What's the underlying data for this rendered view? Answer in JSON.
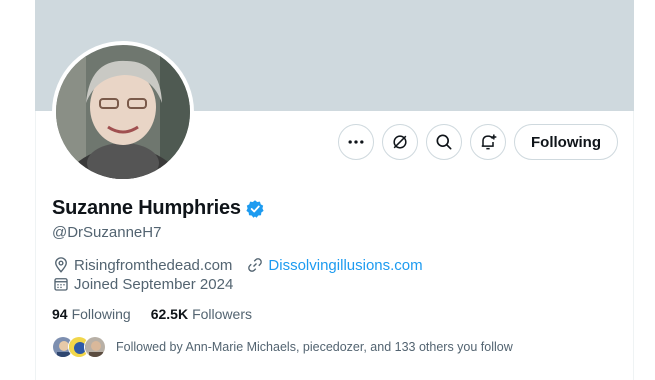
{
  "profile": {
    "name": "Suzanne Humphries",
    "handle": "@DrSuzanneH7",
    "location": "Risingfromthedead.com",
    "website": "Dissolvingillusions.com",
    "joined": "Joined September 2024",
    "following_count": "94",
    "following_label": "Following",
    "followers_count": "62.5K",
    "followers_label": "Followers",
    "followed_by": "Followed by Ann-Marie Michaels, piecedozer, and 133 others you follow"
  },
  "actions": {
    "more_icon": "more-horizontal-icon",
    "grok_icon": "grok-icon",
    "search_icon": "search-icon",
    "notify_icon": "bell-plus-icon",
    "following_button": "Following"
  },
  "colors": {
    "banner": "#cfd9de",
    "link": "#1d9bf0",
    "verified": "#1d9bf0",
    "secondary_text": "#536471"
  }
}
